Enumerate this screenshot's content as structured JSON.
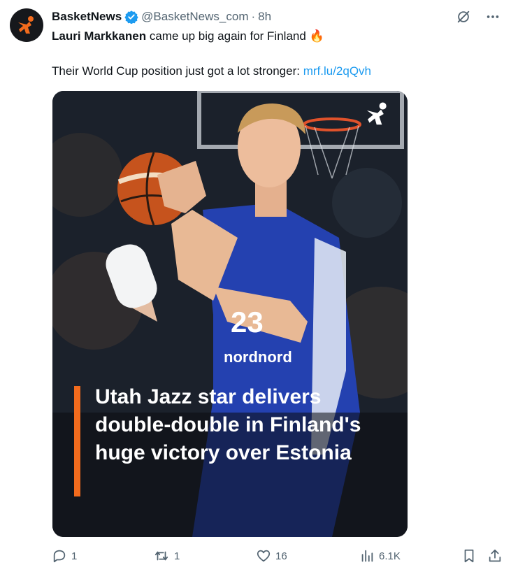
{
  "tweet": {
    "author_name": "BasketNews",
    "handle": "@BasketNews_com",
    "separator": "·",
    "time": "8h",
    "text_bold": "Lauri Markkanen",
    "text_rest": " came up big again for Finland ",
    "emoji": "🔥",
    "line2_text": "Their World Cup position just got a lot stronger: ",
    "link": "mrf.lu/2qQvh"
  },
  "media": {
    "headline": "Utah Jazz star delivers double-double in Finland's huge victory over Estonia",
    "jersey_number": "23",
    "jersey_sponsor": "nordnord",
    "accent_color": "#f26b1d"
  },
  "actions": {
    "replies": "1",
    "reposts": "1",
    "likes": "16",
    "views": "6.1K"
  },
  "colors": {
    "text": "#0f1419",
    "muted": "#536471",
    "link": "#1d9bf0",
    "verified": "#1d9bf0"
  }
}
